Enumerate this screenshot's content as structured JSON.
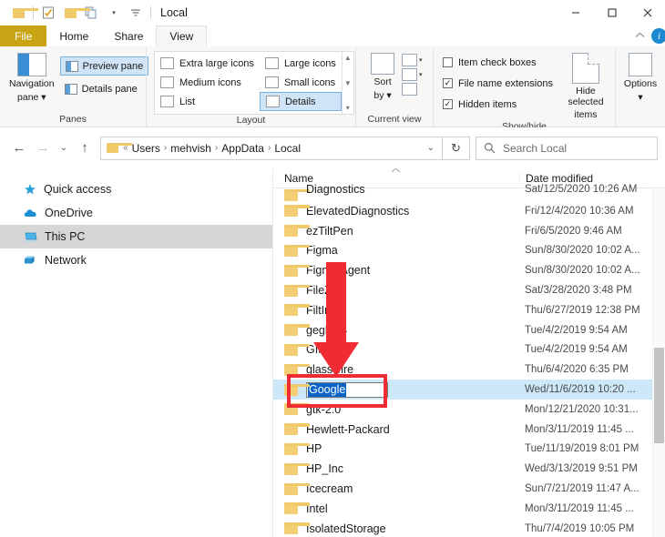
{
  "window": {
    "title": "Local",
    "quick_access": [
      "folder-icon",
      "properties-icon",
      "new-folder-icon",
      "customize-icon"
    ],
    "minimize": "—",
    "maximize": "☐",
    "close": "✕",
    "collapse_ribbon": "⌃",
    "help": "i"
  },
  "tabs": [
    {
      "label": "File",
      "state": "file"
    },
    {
      "label": "Home",
      "state": "normal"
    },
    {
      "label": "Share",
      "state": "normal"
    },
    {
      "label": "View",
      "state": "active"
    }
  ],
  "ribbon": {
    "groups": [
      {
        "label": "Panes"
      },
      {
        "label": "Layout"
      },
      {
        "label": "Current view"
      },
      {
        "label": "Show/hide"
      },
      {
        "label": ""
      }
    ],
    "panes": {
      "navigation_pane": "Navigation\npane",
      "navigation_pane_line1": "Navigation",
      "navigation_pane_line2": "pane ▾",
      "preview_pane": "Preview pane",
      "details_pane": "Details pane"
    },
    "layout": {
      "extra_large_icons": "Extra large icons",
      "large_icons": "Large icons",
      "medium_icons": "Medium icons",
      "small_icons": "Small icons",
      "list": "List",
      "details": "Details",
      "selected": "Details",
      "scroll_up": "▲",
      "scroll_down": "▼",
      "scroll_more": "▾"
    },
    "current_view": {
      "sort_by_line1": "Sort",
      "sort_by_line2": "by ▾"
    },
    "show_hide": {
      "item_check_boxes": {
        "label": "Item check boxes",
        "checked": false
      },
      "file_name_extensions": {
        "label": "File name extensions",
        "checked": true
      },
      "hidden_items": {
        "label": "Hidden items",
        "checked": true
      },
      "hide_selected_items_line1": "Hide selected",
      "hide_selected_items_line2": "items"
    },
    "options": {
      "label_line1": "Options",
      "label_line2": "▾"
    }
  },
  "address": {
    "back": "←",
    "forward": "→",
    "recent": "⌄",
    "up": "↑",
    "chevrons": "«",
    "crumbs": [
      "Users",
      "mehvish",
      "AppData",
      "Local"
    ],
    "separator": "›",
    "dropdown": "⌄",
    "refresh": "↻",
    "search_placeholder": "Search Local",
    "search_value": "",
    "search_icon": "⌕"
  },
  "sidebar": {
    "items": [
      {
        "label": "Quick access",
        "icon": "star-icon",
        "selected": false
      },
      {
        "label": "OneDrive",
        "icon": "cloud-icon",
        "selected": false
      },
      {
        "label": "This PC",
        "icon": "computer-icon",
        "selected": true
      },
      {
        "label": "Network",
        "icon": "network-icon",
        "selected": false
      }
    ]
  },
  "filelist": {
    "columns": {
      "name": "Name",
      "date_modified": "Date modified"
    },
    "sort_indicator": "⌃",
    "rows": [
      {
        "name": "Diagnostics",
        "date": "Sat/12/5/2020 10:26 AM",
        "selected": false,
        "partial": true
      },
      {
        "name": "ElevatedDiagnostics",
        "date": "Fri/12/4/2020 10:36 AM",
        "selected": false
      },
      {
        "name": "ezTiltPen",
        "date": "Fri/6/5/2020 9:46 AM",
        "selected": false
      },
      {
        "name": "Figma",
        "date": "Sun/8/30/2020 10:02 A...",
        "selected": false
      },
      {
        "name": "Figma Agent",
        "date": "Sun/8/30/2020 10:02 A...",
        "selected": false
      },
      {
        "name": "FileZilla",
        "date": "Sat/3/28/2020 3:48 PM",
        "selected": false
      },
      {
        "name": "FiltInfo",
        "date": "Thu/6/27/2019 12:38 PM",
        "selected": false
      },
      {
        "name": "gegl-0.4",
        "date": "Tue/4/2/2019 9:54 AM",
        "selected": false
      },
      {
        "name": "GIMP",
        "date": "Tue/4/2/2019 9:54 AM",
        "selected": false
      },
      {
        "name": "glasswire",
        "date": "Thu/6/4/2020 6:35 PM",
        "selected": false
      },
      {
        "name": "Google",
        "date": "Wed/11/6/2019 10:20 ...",
        "selected": true,
        "renaming": true
      },
      {
        "name": "gtk-2.0",
        "date": "Mon/12/21/2020 10:31...",
        "selected": false
      },
      {
        "name": "Hewlett-Packard",
        "date": "Mon/3/11/2019 11:45 ...",
        "selected": false
      },
      {
        "name": "HP",
        "date": "Tue/11/19/2019 8:01 PM",
        "selected": false
      },
      {
        "name": "HP_Inc",
        "date": "Wed/3/13/2019 9:51 PM",
        "selected": false
      },
      {
        "name": "Icecream",
        "date": "Sun/7/21/2019 11:47 A...",
        "selected": false
      },
      {
        "name": "Intel",
        "date": "Mon/3/11/2019 11:45 ...",
        "selected": false
      },
      {
        "name": "IsolatedStorage",
        "date": "Thu/7/4/2019 10:05 PM",
        "selected": false
      }
    ],
    "rename_value": "Google"
  },
  "annotations": {
    "highlight_color": "#ef2b33",
    "arrow_color": "#ef2b33",
    "arrow_target": "Google",
    "highlight_target": "Google rename field"
  }
}
